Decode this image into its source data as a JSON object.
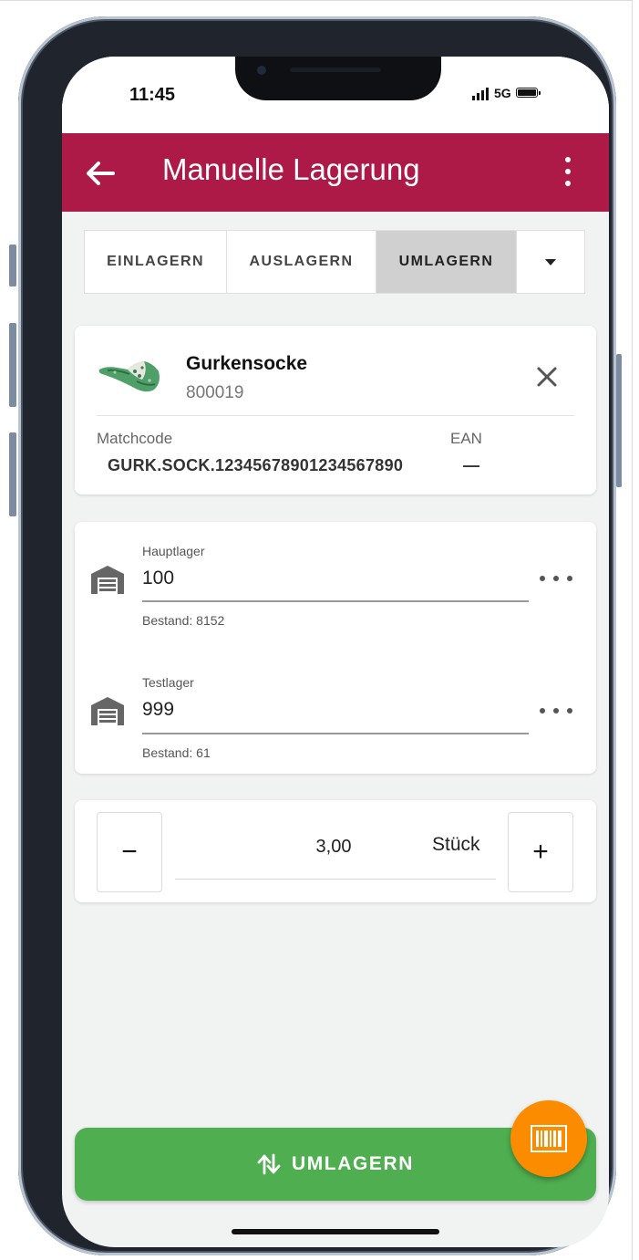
{
  "status_bar": {
    "time": "11:45",
    "network": "5G"
  },
  "app_bar": {
    "title": "Manuelle Lagerung"
  },
  "tabs": [
    {
      "label": "EINLAGERN",
      "active": false
    },
    {
      "label": "AUSLAGERN",
      "active": false
    },
    {
      "label": "UMLAGERN",
      "active": true
    }
  ],
  "product": {
    "name": "Gurkensocke",
    "number": "800019",
    "matchcode_label": "Matchcode",
    "matchcode": "GURK.SOCK.12345678901234567890",
    "ean_label": "EAN",
    "ean": "—"
  },
  "locations": [
    {
      "warehouse": "Hauptlager",
      "value": "100",
      "stock": "Bestand: 8152"
    },
    {
      "warehouse": "Testlager",
      "value": "999",
      "stock": "Bestand: 61"
    }
  ],
  "quantity": {
    "minus": "−",
    "value": "3,00",
    "unit": "Stück",
    "plus": "+"
  },
  "action": {
    "label": "UMLAGERN"
  },
  "colors": {
    "app_bar": "#ad1a47",
    "primary_action": "#4fae50",
    "fab": "#fb8c00",
    "background": "#f1f2f2"
  },
  "icons": [
    "back-arrow-icon",
    "more-vert-icon",
    "dropdown-caret-icon",
    "close-icon",
    "warehouse-icon",
    "more-horiz-icon",
    "swap-vert-icon",
    "barcode-icon"
  ]
}
